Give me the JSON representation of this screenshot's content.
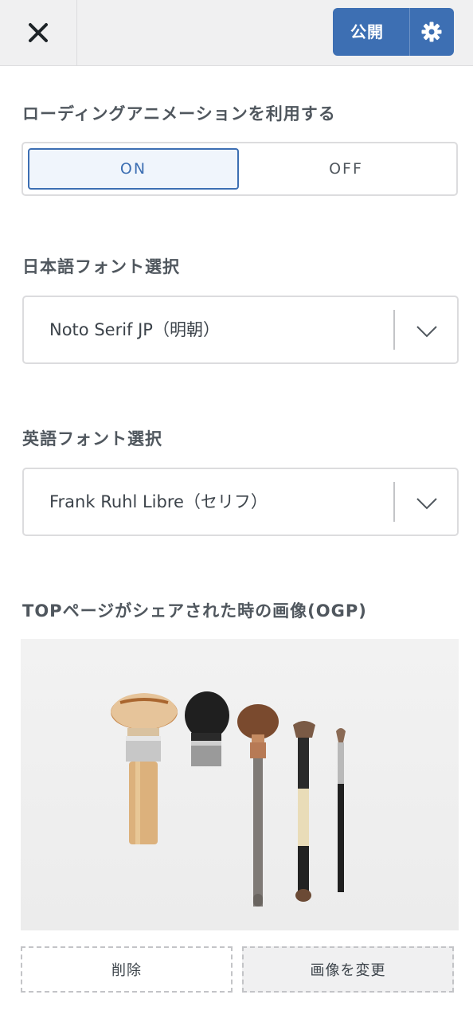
{
  "header": {
    "close_icon": "close-icon",
    "publish_label": "公開",
    "settings_icon": "gear-icon",
    "accent_color": "#3d6fb3"
  },
  "loading_animation": {
    "label": "ローディングアニメーションを利用する",
    "on_label": "ON",
    "off_label": "OFF",
    "selected": "ON"
  },
  "japanese_font": {
    "label": "日本語フォント選択",
    "value": "Noto Serif JP（明朝）",
    "dropdown_icon": "chevron-down-icon"
  },
  "english_font": {
    "label": "英語フォント選択",
    "value": "Frank Ruhl Libre（セリフ）",
    "dropdown_icon": "chevron-down-icon"
  },
  "ogp": {
    "label": "TOPページがシェアされた時の画像(OGP)",
    "image_alt": "makeup brushes",
    "delete_label": "削除",
    "change_label": "画像を変更"
  }
}
